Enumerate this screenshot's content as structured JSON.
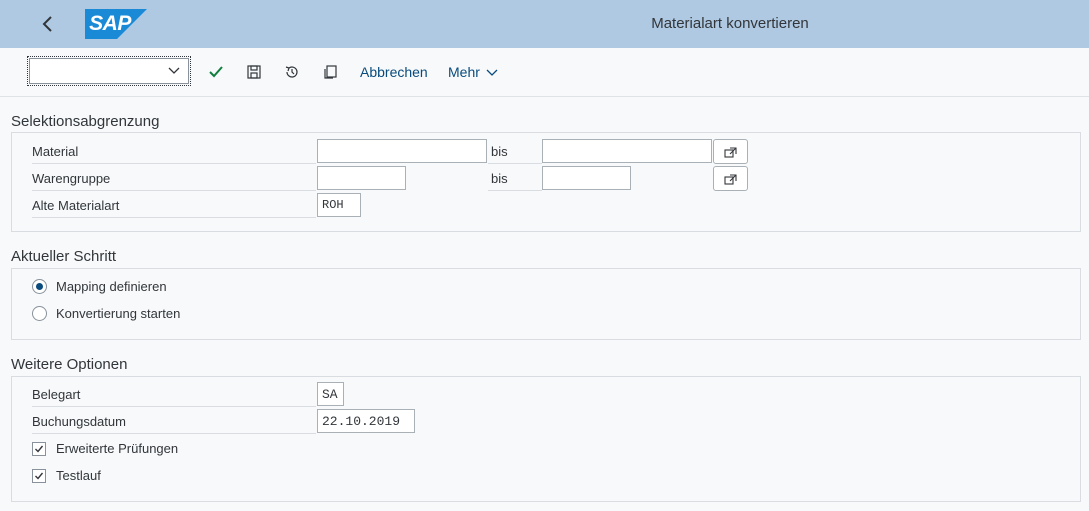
{
  "shell": {
    "logo_text": "SAP",
    "title": "Materialart konvertieren",
    "brand_color": "#1b8ad6"
  },
  "toolbar": {
    "okcode_value": "",
    "icons": [
      "check-icon",
      "save-icon",
      "history-icon",
      "copy-icon"
    ],
    "cancel_label": "Abbrechen",
    "more_label": "Mehr"
  },
  "selection": {
    "title": "Selektionsabgrenzung",
    "material_label": "Material",
    "material_from": "",
    "material_to": "",
    "material_group_label": "Warengruppe",
    "material_group_from": "",
    "material_group_to": "",
    "bis_label": "bis",
    "old_type_label": "Alte Materialart",
    "old_type_value": "ROH"
  },
  "step": {
    "title": "Aktueller Schritt",
    "options": [
      {
        "label": "Mapping definieren",
        "selected": true
      },
      {
        "label": "Konvertierung starten",
        "selected": false
      }
    ]
  },
  "options": {
    "title": "Weitere Optionen",
    "doc_type_label": "Belegart",
    "doc_type_value": "SA",
    "posting_date_label": "Buchungsdatum",
    "posting_date_value": "22.10.2019",
    "checks": [
      {
        "label": "Erweiterte Prüfungen",
        "checked": true
      },
      {
        "label": "Testlauf",
        "checked": true
      }
    ]
  },
  "colors": {
    "accent": "#0a4b7d",
    "check_green": "#107e3e",
    "header_bg": "#afc9e2"
  }
}
